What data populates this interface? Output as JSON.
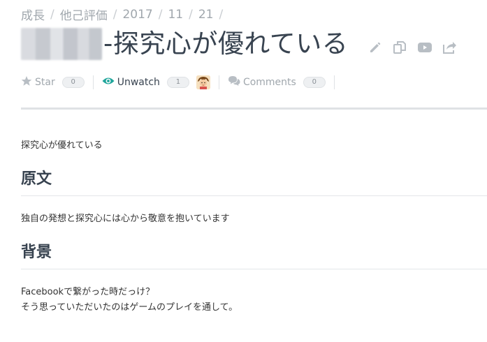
{
  "breadcrumb": [
    "成長",
    "他己評価",
    "2017",
    "11",
    "21"
  ],
  "title": "-探究心が優れている",
  "title_actions": [
    "pencil-icon",
    "copy-icon",
    "slideshow-icon",
    "share-icon"
  ],
  "meta": {
    "star_label": "Star",
    "star_count": "0",
    "watch_label": "Unwatch",
    "watch_count": "1",
    "comments_label": "Comments",
    "comments_count": "0"
  },
  "body": {
    "intro": "探究心が優れている",
    "section1_heading": "原文",
    "section1_text": "独自の発想と探究心には心から敬意を抱いています",
    "section2_heading": "背景",
    "section2_line1": "Facebookで繋がった時だっけ？",
    "section2_line2": "そう思っていただいたのはゲームのプレイを通して。"
  },
  "colors": {
    "accent_teal": "#1fa59b",
    "heading": "#384350",
    "muted": "#a0a7ad"
  }
}
